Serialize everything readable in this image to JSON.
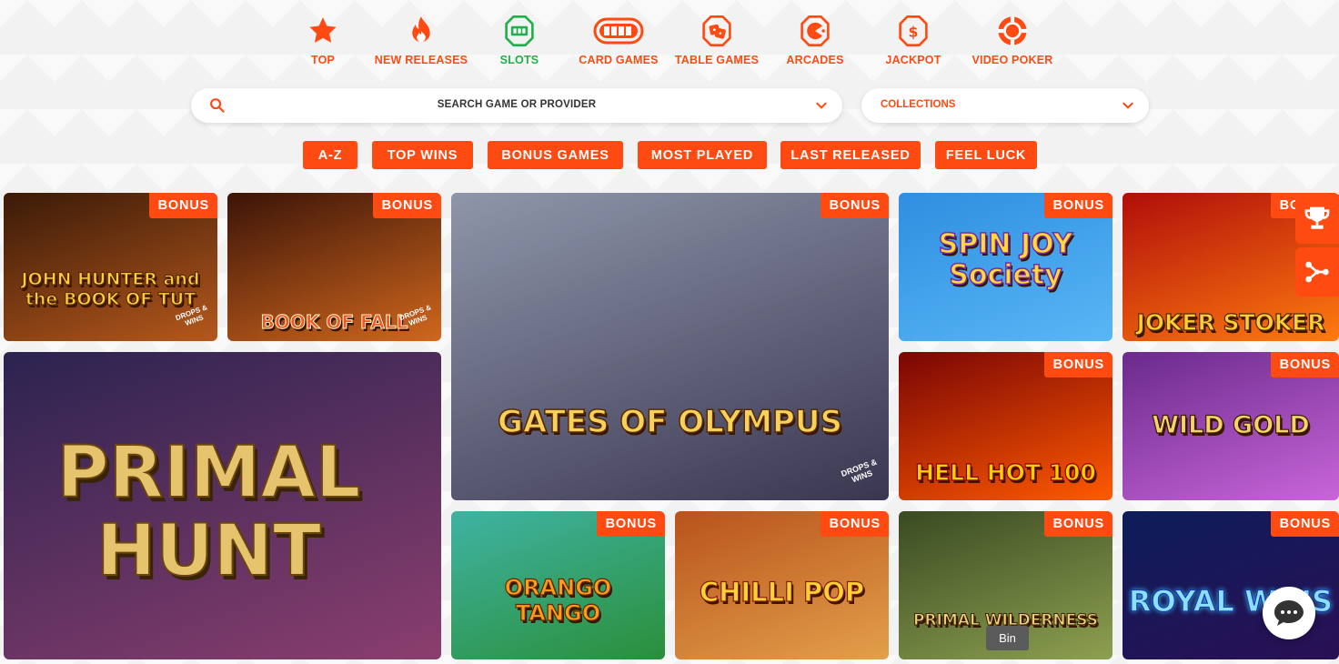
{
  "nav": {
    "items": [
      {
        "label": "TOP",
        "icon": "star-icon"
      },
      {
        "label": "NEW RELEASES",
        "icon": "flame-icon"
      },
      {
        "label": "SLOTS",
        "icon": "slot-machine-icon"
      },
      {
        "label": "CARD GAMES",
        "icon": "cards-icon"
      },
      {
        "label": "TABLE GAMES",
        "icon": "dice-icon"
      },
      {
        "label": "ARCADES",
        "icon": "pacman-icon"
      },
      {
        "label": "JACKPOT",
        "icon": "dollar-icon"
      },
      {
        "label": "VIDEO POKER",
        "icon": "poker-chip-icon"
      }
    ]
  },
  "search": {
    "placeholder": "SEARCH GAME OR PROVIDER"
  },
  "collections": {
    "label": "COLLECTIONS"
  },
  "filters": [
    "A-Z",
    "TOP WINS",
    "BONUS GAMES",
    "MOST PLAYED",
    "LAST RELEASED",
    "FEEL LUCK"
  ],
  "badge_label": "BONUS",
  "drops_label": "DROPS & WINS",
  "games": [
    {
      "title": "JOHN HUNTER and the BOOK OF TUT",
      "colors": [
        "#3a1a08",
        "#b5581c"
      ]
    },
    {
      "title": "BOOK OF FALL",
      "colors": [
        "#3b1408",
        "#d0671d"
      ]
    },
    {
      "title": "GATES OF OLYMPUS",
      "colors": [
        "#8e96aa",
        "#3a3650"
      ]
    },
    {
      "title": "SPIN JOY Society",
      "colors": [
        "#2f8ee0",
        "#58b7f5"
      ]
    },
    {
      "title": "JOKER STOKER",
      "colors": [
        "#b00e0a",
        "#ff7b0f"
      ]
    },
    {
      "title": "PRIMAL HUNT",
      "colors": [
        "#2b2350",
        "#8b3e6e"
      ]
    },
    {
      "title": "HELL HOT 100",
      "colors": [
        "#7a0505",
        "#ff5a00"
      ]
    },
    {
      "title": "WILD GOLD",
      "colors": [
        "#6a2a8c",
        "#c865d9"
      ]
    },
    {
      "title": "ORANGO TANGO",
      "colors": [
        "#3fb3a3",
        "#2a8f3a"
      ]
    },
    {
      "title": "CHILLI POP",
      "colors": [
        "#b8531c",
        "#e3a04a"
      ]
    },
    {
      "title": "PRIMAL WILDERNESS",
      "colors": [
        "#3a4a22",
        "#8da050"
      ]
    },
    {
      "title": "ROYAL WINS",
      "colors": [
        "#0d1d5a",
        "#2a1055"
      ]
    }
  ],
  "tooltip": "Bin",
  "side": {
    "trophy_icon": "trophy-icon",
    "share_icon": "share-icon"
  }
}
